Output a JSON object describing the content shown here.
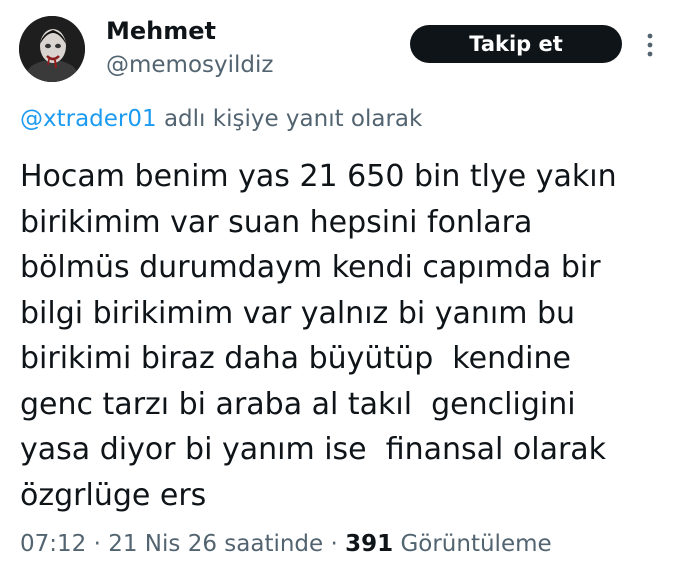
{
  "author": {
    "display_name": "Mehmet",
    "handle": "@memosyildiz",
    "avatar_icon": "profile-avatar-icon"
  },
  "follow_button": {
    "label": "Takip et"
  },
  "more_menu": {
    "icon": "vertical-ellipsis-icon"
  },
  "reply_context": {
    "mention": "@xtrader01",
    "suffix": " adlı kişiye yanıt olarak"
  },
  "tweet": {
    "lines": [
      "Hocam benim yas 21 650 bin tlye yakın",
      "birikimim var suan hepsini fonlara",
      "bölmüs durumdaym kendi capımda bir",
      "bilgi birikimim var yalnız bi yanım bu",
      "birikimi biraz daha büyütüp  kendine",
      "genc tarzı bi araba al takıl  gencligini",
      "yasa diyor bi yanım ise  finansal olarak",
      "özgrlüge ers"
    ]
  },
  "meta": {
    "time": "07:12",
    "separator": " · ",
    "date": "21 Nis 26 saatinde",
    "views_count": "391",
    "views_label": " Görüntüleme"
  },
  "colors": {
    "text_primary": "#0f1419",
    "text_secondary": "#536471",
    "accent_link": "#1d9bf0",
    "button_bg": "#0f1419",
    "button_text": "#ffffff"
  }
}
